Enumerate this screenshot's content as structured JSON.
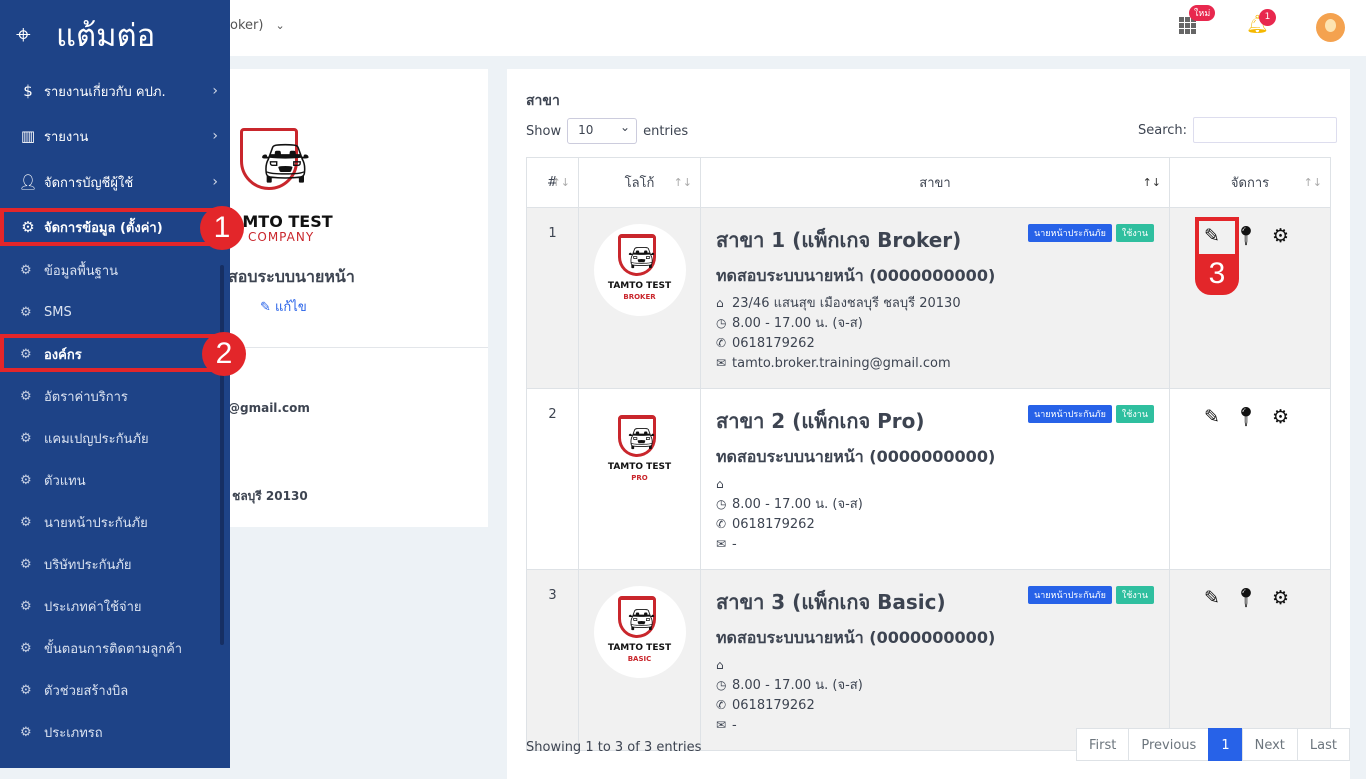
{
  "header": {
    "selector_text": "oker)",
    "new_badge": "ใหม่",
    "notification_count": "1"
  },
  "sidebar": {
    "brand": "แต้มต่อ",
    "items": [
      {
        "label": "รายงานเกี่ยวกับ คปภ.",
        "icon": "money-report-icon"
      },
      {
        "label": "รายงาน",
        "icon": "bar-chart-icon"
      },
      {
        "label": "จัดการบัญชีผู้ใช้",
        "icon": "user-plus-icon"
      },
      {
        "label": "จัดการข้อมูล (ตั้งค่า)",
        "icon": "gears-icon"
      }
    ],
    "subitems": [
      "ข้อมูลพื้นฐาน",
      "SMS",
      "องค์กร",
      "อัตราค่าบริการ",
      "แคมเปญประกันภัย",
      "ตัวแทน",
      "นายหน้าประกันภัย",
      "บริษัทประกันภัย",
      "ประเภทค่าใช้จ่าย",
      "ขั้นตอนการติดตามลูกค้า",
      "ตัวช่วยสร้างบิล",
      "ประเภทรถ"
    ]
  },
  "annotations": {
    "step1": "1",
    "step2": "2",
    "step3": "3",
    "highlight_color": "#e3262a"
  },
  "company": {
    "logo_line1": "AMTO TEST",
    "logo_line2": "COMPANY",
    "name": "สอบระบบนายหน้า",
    "edit_label": "แก้ไข",
    "email": "@gmail.com",
    "address": "ี ชลบุรี 20130"
  },
  "branches": {
    "title": "สาขา",
    "show": "Show",
    "entries_value": "10",
    "entries": "entries",
    "search_label": "Search:",
    "search_value": "",
    "columns": [
      "#",
      "โลโก้",
      "สาขา",
      "จัดการ"
    ],
    "rows": [
      {
        "no": "1",
        "logo_t1": "TAMTO TEST",
        "logo_t2": "BROKER",
        "name": "สาขา 1 (แพ็กเกจ Broker)",
        "company": "ทดสอบระบบนายหน้า (0000000000)",
        "address": "23/46 แสนสุข เมืองชลบุรี ชลบุรี 20130",
        "hours": "8.00 - 17.00 น. (จ-ส)",
        "phone": "0618179262",
        "email": "tamto.broker.training@gmail.com",
        "tag1": "นายหน้าประกันภัย",
        "tag2": "ใช้งาน"
      },
      {
        "no": "2",
        "logo_t1": "TAMTO TEST",
        "logo_t2": "PRO",
        "name": "สาขา 2 (แพ็กเกจ Pro)",
        "company": "ทดสอบระบบนายหน้า (0000000000)",
        "address": "",
        "hours": "8.00 - 17.00 น. (จ-ส)",
        "phone": "0618179262",
        "email": "-",
        "tag1": "นายหน้าประกันภัย",
        "tag2": "ใช้งาน"
      },
      {
        "no": "3",
        "logo_t1": "TAMTO TEST",
        "logo_t2": "BASIC",
        "name": "สาขา 3 (แพ็กเกจ Basic)",
        "company": "ทดสอบระบบนายหน้า (0000000000)",
        "address": "",
        "hours": "8.00 - 17.00 น. (จ-ส)",
        "phone": "0618179262",
        "email": "-",
        "tag1": "นายหน้าประกันภัย",
        "tag2": "ใช้งาน"
      }
    ],
    "footer": "Showing 1 to 3 of 3 entries",
    "pager": [
      "First",
      "Previous",
      "1",
      "Next",
      "Last"
    ]
  },
  "colors": {
    "sidebar": "#1e4387",
    "primary": "#2762e8",
    "tag_blue": "#2762e8",
    "tag_green": "#2fbf9f"
  }
}
